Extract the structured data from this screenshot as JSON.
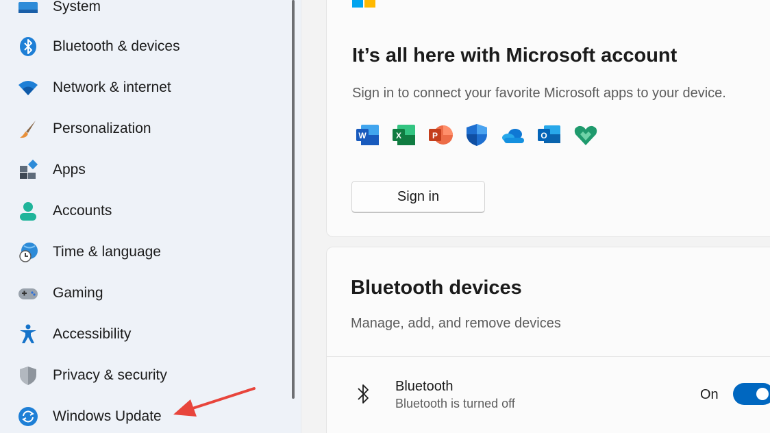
{
  "sidebar": {
    "items": [
      {
        "label": "System",
        "icon": "system-icon"
      },
      {
        "label": "Bluetooth & devices",
        "icon": "bluetooth-icon"
      },
      {
        "label": "Network & internet",
        "icon": "wifi-icon"
      },
      {
        "label": "Personalization",
        "icon": "brush-icon"
      },
      {
        "label": "Apps",
        "icon": "apps-icon"
      },
      {
        "label": "Accounts",
        "icon": "person-icon"
      },
      {
        "label": "Time & language",
        "icon": "globe-clock-icon"
      },
      {
        "label": "Gaming",
        "icon": "gamepad-icon"
      },
      {
        "label": "Accessibility",
        "icon": "accessibility-icon"
      },
      {
        "label": "Privacy & security",
        "icon": "shield-icon"
      },
      {
        "label": "Windows Update",
        "icon": "update-icon"
      }
    ]
  },
  "microsoft_account": {
    "title": "It’s all here with Microsoft account",
    "subtitle": "Sign in to connect your favorite Microsoft apps to your device.",
    "apps": [
      "word-icon",
      "excel-icon",
      "powerpoint-icon",
      "defender-icon",
      "onedrive-icon",
      "outlook-icon",
      "family-icon"
    ],
    "sign_in_label": "Sign in"
  },
  "bluetooth": {
    "title": "Bluetooth devices",
    "subtitle": "Manage, add, and remove devices",
    "row_name": "Bluetooth",
    "row_status": "Bluetooth is turned off",
    "toggle_label": "On"
  },
  "colors": {
    "accent": "#0067c0",
    "annotation_arrow": "#e8453c"
  }
}
